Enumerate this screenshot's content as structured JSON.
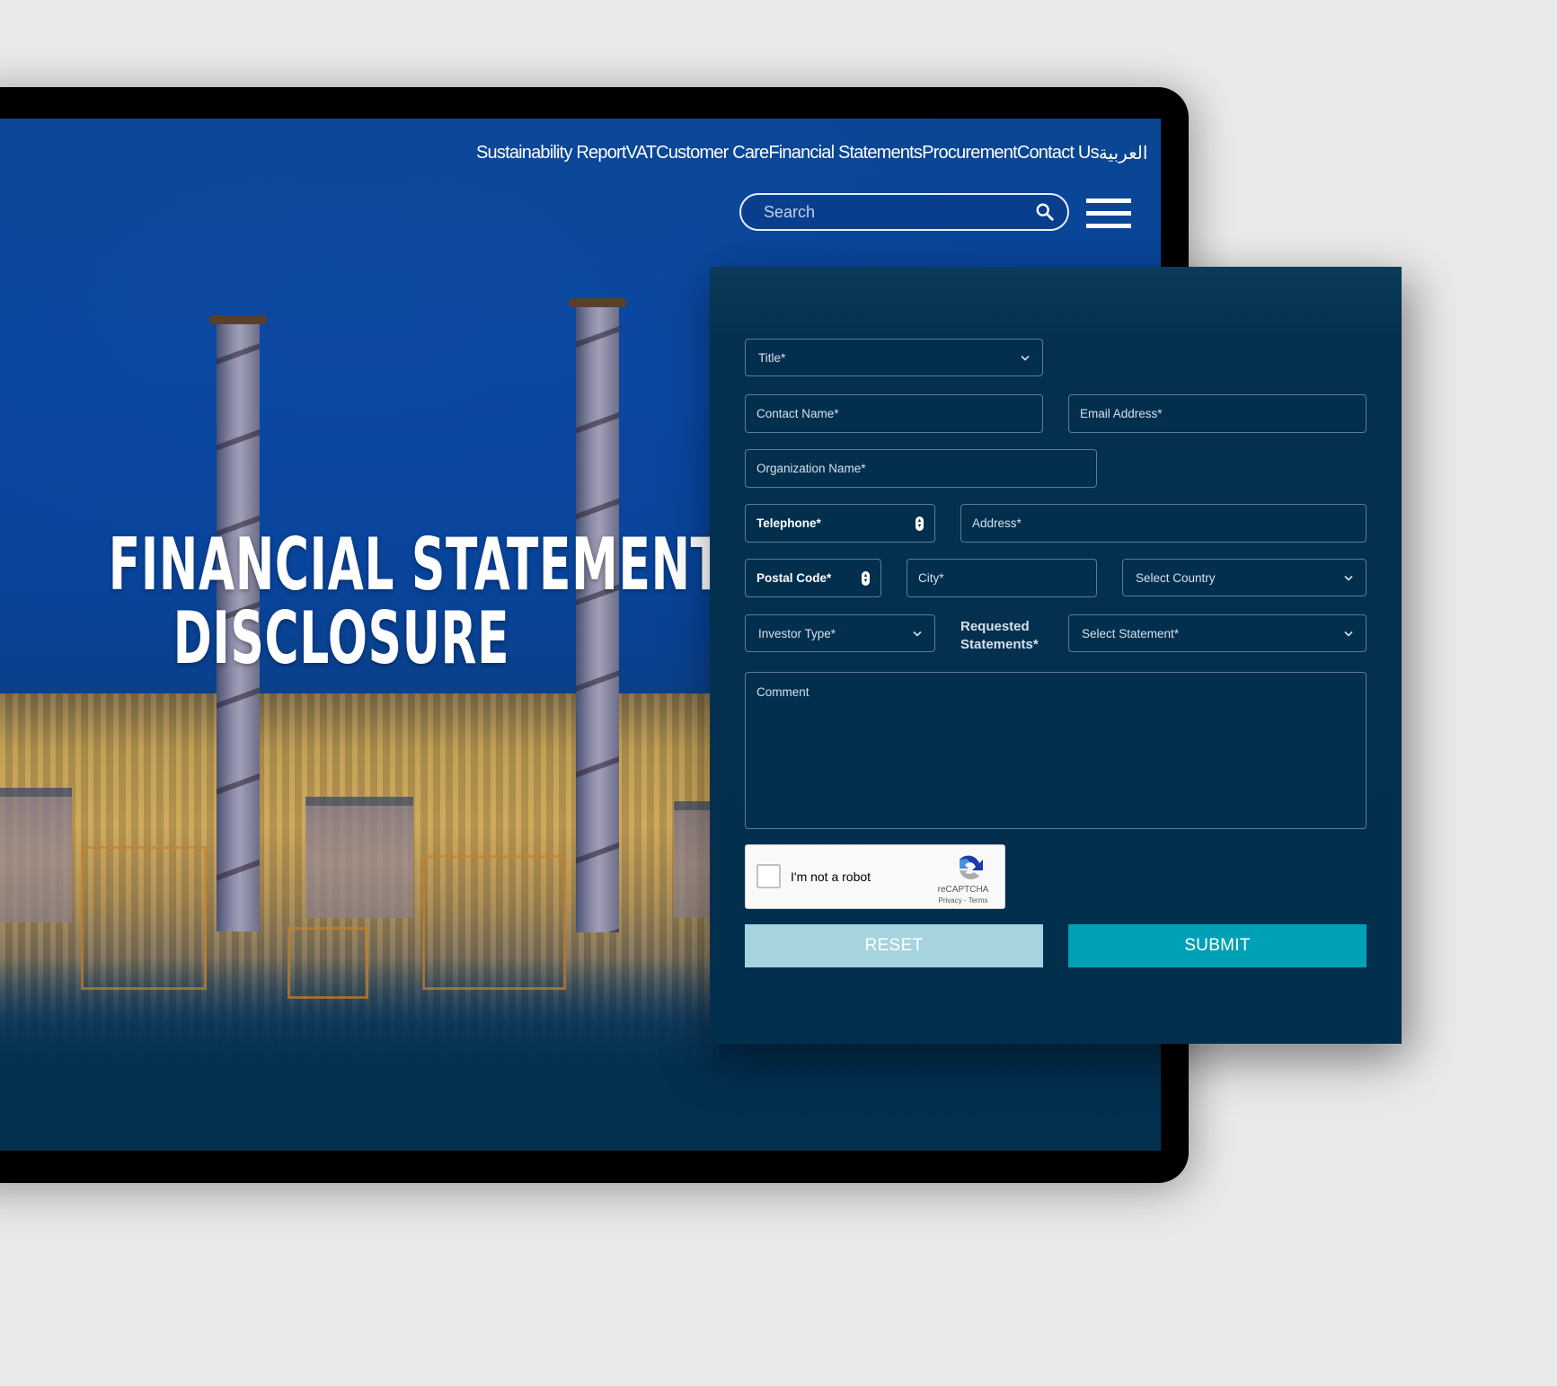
{
  "nav": {
    "links": [
      "Sustainability Report",
      "VAT",
      "Customer Care",
      "Financial Statements",
      "Procurement",
      "Contact Us",
      "العربية"
    ]
  },
  "search": {
    "placeholder": "Search",
    "icon": "search-icon"
  },
  "menu": {
    "icon": "hamburger-menu-icon"
  },
  "hero": {
    "line1": "FINANCIAL STATEMENT",
    "line2": "DISCLOSURE"
  },
  "form": {
    "title_select": {
      "placeholder": "Title*",
      "icon": "chevron-down-icon"
    },
    "contact_name": {
      "placeholder": "Contact Name*"
    },
    "email": {
      "placeholder": "Email Address*"
    },
    "organization": {
      "placeholder": "Organization Name*"
    },
    "telephone": {
      "placeholder": "Telephone*",
      "icon": "number-spinner-icon"
    },
    "address": {
      "placeholder": "Address*"
    },
    "postal_code": {
      "placeholder": "Postal Code*",
      "icon": "number-spinner-icon"
    },
    "city": {
      "placeholder": "City*"
    },
    "country_select": {
      "placeholder": "Select Country",
      "icon": "chevron-down-icon"
    },
    "investor_type_select": {
      "placeholder": "Investor Type*",
      "icon": "chevron-down-icon"
    },
    "requested_statements_label": [
      "Requested",
      "Statements*"
    ],
    "statement_select": {
      "placeholder": "Select Statement*",
      "icon": "chevron-down-icon"
    },
    "comment": {
      "placeholder": "Comment"
    },
    "recaptcha": {
      "label": "I'm not a robot",
      "brand": "reCAPTCHA",
      "links": "Privacy - Terms",
      "checked": false
    },
    "reset_label": "RESET",
    "submit_label": "SUBMIT"
  },
  "colors": {
    "nav_blue": "#0845a0",
    "form_bg": "#032f4f",
    "field_border": "#5d7c94",
    "reset_bg": "#a5d4de",
    "submit_bg": "#00a0b6",
    "page_bg": "#e9e9e9"
  }
}
